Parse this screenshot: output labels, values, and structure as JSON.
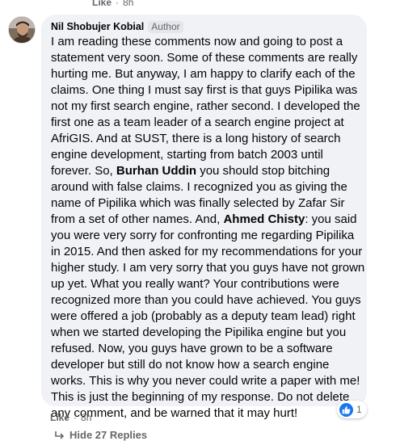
{
  "top_meta": {
    "like_label": "Like",
    "separator": "·",
    "time": "8h"
  },
  "comment": {
    "author_name": "Nil Shobujer Kobial",
    "author_badge": "Author",
    "text_parts": {
      "p1": "I am reading these comments now and going to post a statement very soon. Some of these comments are really hurting me. But anyway, I am happy to clarify each of the claims. One thing I must say first is that guys Pipilika was not my first search engine, rather second. I developed the first one as a team leader of a search engine project at AfriGIS. And at SUST, there is a long history of search engine development, starting from batch 2003 until forever. So, ",
      "mention1": "Burhan Uddin",
      "p2": " you should stop bitching around with false claims. I recognized you as giving the name of Pipilika which was finally selected by Zafar Sir from a set of other names. And, ",
      "mention2": "Ahmed Chisty",
      "p3": ": you said you were very sorry for confronting me regarding Pipilika in 2015. And then asked for my recommendations for your higher study. I am very sorry that you guys have not grown up yet. What you really want? Your contributions were recognized more than you could have achieved. You guys were offered a job (probably as a deputy team lead) right when we started developing the Pipilika engine but you refused. Now, you guys have grown to be a software developer but still do not know how a search engine works. This is why you never could write a paper with me! This is just the beginning of my response. Do not delete any comment, and be warned that it may hurt!"
    },
    "reaction_count": "1",
    "like_label": "Like",
    "separator": "·",
    "time": "8h"
  },
  "replies_label": "Hide 27 Replies",
  "colors": {
    "bubble": "#f0f2f5",
    "accent": "#1877f2",
    "meta": "#65676b"
  },
  "icons": {
    "reaction": "thumbs-up-icon",
    "replies": "reply-arrow-icon"
  }
}
